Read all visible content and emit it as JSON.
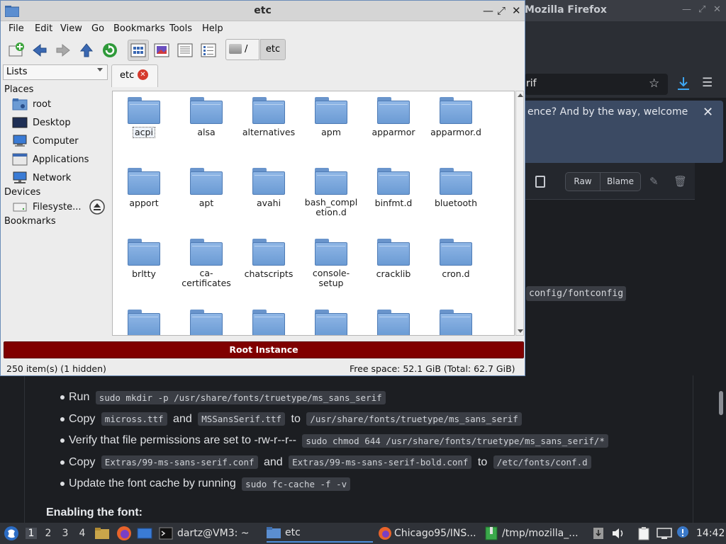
{
  "firefox": {
    "title": "Mozilla Firefox",
    "url_fragment": "rif",
    "notice_text": "ence? And by the way, welcome",
    "raw_label": "Raw",
    "blame_label": "Blame",
    "inline_code": "config/fontconfig",
    "list": [
      {
        "parts": [
          {
            "t": "Run "
          },
          {
            "c": "sudo mkdir -p /usr/share/fonts/truetype/ms_sans_serif"
          }
        ]
      },
      {
        "parts": [
          {
            "t": "Copy "
          },
          {
            "c": "micross.ttf"
          },
          {
            "t": " and "
          },
          {
            "c": "MSSansSerif.ttf"
          },
          {
            "t": " to "
          },
          {
            "c": "/usr/share/fonts/truetype/ms_sans_serif"
          }
        ]
      },
      {
        "parts": [
          {
            "t": "Verify that file permissions are set to -rw-r--r-- "
          },
          {
            "c": "sudo chmod 644 /usr/share/fonts/truetype/ms_sans_serif/*"
          }
        ]
      },
      {
        "parts": [
          {
            "t": "Copy "
          },
          {
            "c": "Extras/99-ms-sans-serif.conf"
          },
          {
            "t": " and "
          },
          {
            "c": "Extras/99-ms-sans-serif-bold.conf"
          },
          {
            "t": " to "
          },
          {
            "c": "/etc/fonts/conf.d"
          }
        ]
      },
      {
        "parts": [
          {
            "t": "Update the font cache by running "
          },
          {
            "c": "sudo fc-cache -f -v"
          }
        ]
      }
    ],
    "heading": "Enabling the font:"
  },
  "fm": {
    "title": "etc",
    "menu": [
      "File",
      "Edit",
      "View",
      "Go",
      "Bookmarks",
      "Tools",
      "Help"
    ],
    "path_root": "/",
    "path_current": "etc",
    "side_mode": "Lists",
    "places_head": "Places",
    "places": [
      "root",
      "Desktop",
      "Computer",
      "Applications",
      "Network"
    ],
    "devices_head": "Devices",
    "devices": [
      "Filesyste..."
    ],
    "bookmarks_head": "Bookmarks",
    "tab_label": "etc",
    "folders": [
      "acpi",
      "alsa",
      "alternatives",
      "apm",
      "apparmor",
      "apparmor.d",
      "apport",
      "apt",
      "avahi",
      "bash_compl\netion.d",
      "binfmt.d",
      "bluetooth",
      "brltty",
      "ca-\ncertificates",
      "chatscripts",
      "console-\nsetup",
      "cracklib",
      "cron.d",
      "",
      "",
      "",
      "",
      "",
      ""
    ],
    "selected_folder": "acpi",
    "root_instance": "Root Instance",
    "status_items": "250 item(s) (1 hidden)",
    "status_space": "Free space: 52.1 GiB (Total: 62.7 GiB)"
  },
  "taskbar": {
    "workspaces": [
      "1",
      "2",
      "3",
      "4"
    ],
    "active_workspace": "1",
    "tasks": [
      "dartz@VM3: ~",
      "etc",
      "Chicago95/INS...",
      "/tmp/mozilla_..."
    ],
    "active_task": "etc",
    "clock": "14:42"
  },
  "colors": {
    "root_bar": "#800000",
    "folder_blue": "#6b9bd4",
    "firefox_bg": "#1c1e22",
    "download_accent": "#3ea6f2"
  }
}
